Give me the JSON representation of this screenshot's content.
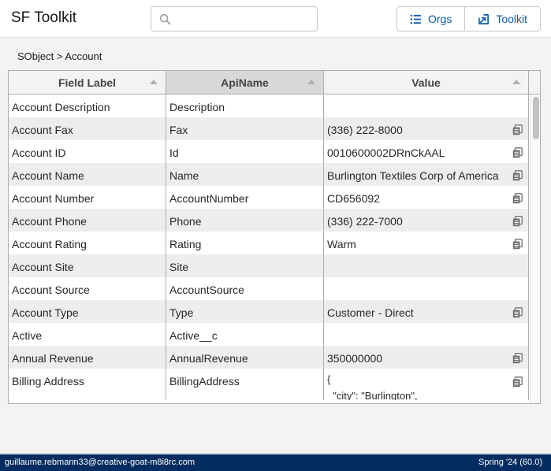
{
  "header": {
    "title": "SF Toolkit",
    "search": {
      "value": "",
      "placeholder": ""
    },
    "buttons": {
      "orgs_label": "Orgs",
      "toolkit_label": "Toolkit"
    }
  },
  "breadcrumb": "SObject > Account",
  "table": {
    "columns": [
      "Field Label",
      "ApiName",
      "Value"
    ],
    "rows": [
      {
        "label": "Account Description",
        "api": "Description",
        "value": "",
        "copy": false
      },
      {
        "label": "Account Fax",
        "api": "Fax",
        "value": "(336) 222-8000",
        "copy": true
      },
      {
        "label": "Account ID",
        "api": "Id",
        "value": "0010600002DRnCkAAL",
        "copy": true
      },
      {
        "label": "Account Name",
        "api": "Name",
        "value": "Burlington Textiles Corp of America",
        "copy": true
      },
      {
        "label": "Account Number",
        "api": "AccountNumber",
        "value": "CD656092",
        "copy": true
      },
      {
        "label": "Account Phone",
        "api": "Phone",
        "value": "(336) 222-7000",
        "copy": true
      },
      {
        "label": "Account Rating",
        "api": "Rating",
        "value": "Warm",
        "copy": true
      },
      {
        "label": "Account Site",
        "api": "Site",
        "value": "",
        "copy": false
      },
      {
        "label": "Account Source",
        "api": "AccountSource",
        "value": "",
        "copy": false
      },
      {
        "label": "Account Type",
        "api": "Type",
        "value": "Customer - Direct",
        "copy": true
      },
      {
        "label": "Active",
        "api": "Active__c",
        "value": "",
        "copy": false
      },
      {
        "label": "Annual Revenue",
        "api": "AnnualRevenue",
        "value": "350000000",
        "copy": true
      },
      {
        "label": "Billing Address",
        "api": "BillingAddress",
        "value": "{\n  \"city\": \"Burlington\",",
        "copy": true,
        "tall": true
      }
    ]
  },
  "footer": {
    "user": "guillaume.rebmann33@creative-goat-m8i8rc.com",
    "version": "Spring '24 (60.0)"
  },
  "colors": {
    "accent": "#0b5cab",
    "footer_bg": "#032d60"
  },
  "icons": {
    "search": "search-icon",
    "orgs": "list-icon",
    "toolkit": "upload-box-icon",
    "copy": "copy-icon"
  }
}
